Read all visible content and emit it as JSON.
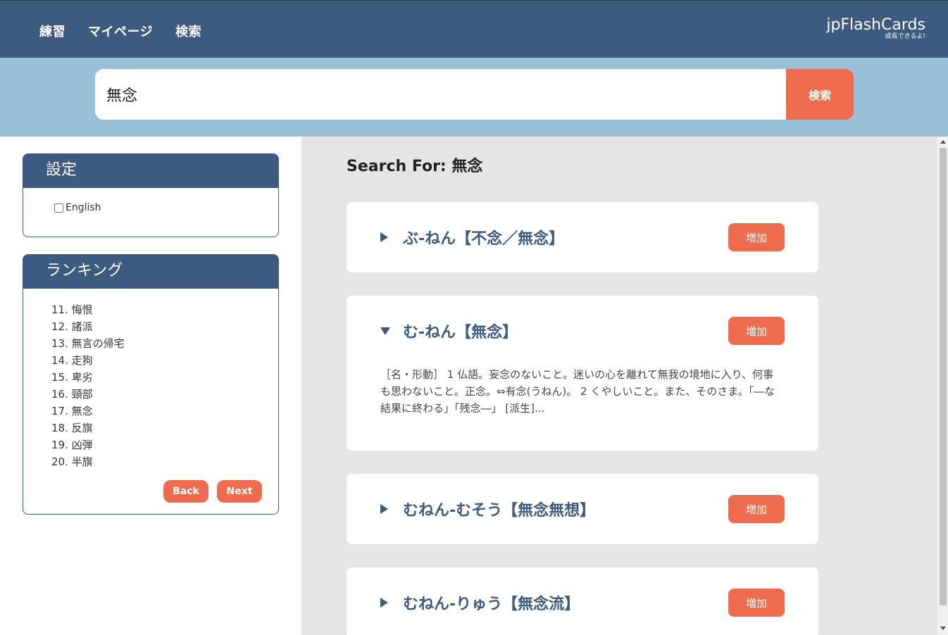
{
  "nav": {
    "items": [
      {
        "label": "練習"
      },
      {
        "label": "マイページ"
      },
      {
        "label": "検索"
      }
    ]
  },
  "brand": {
    "name": "jpFlashCards",
    "tagline": "成長できるよ!"
  },
  "search": {
    "value": "無念",
    "button_label": "検索"
  },
  "settings": {
    "title": "設定",
    "english_label": "English",
    "english_checked": false
  },
  "ranking": {
    "title": "ランキング",
    "items": [
      "11. 悔恨",
      "12. 諸派",
      "13. 無言の帰宅",
      "14. 走狗",
      "15. 卑劣",
      "16. 頸部",
      "17. 無念",
      "18. 反旗",
      "19. 凶弾",
      "20. 半旗"
    ],
    "back_label": "Back",
    "next_label": "Next"
  },
  "results": {
    "heading": "Search For: 無念",
    "add_label": "増加",
    "cards": [
      {
        "title": "ぶ-ねん【不念／無念】",
        "expanded": false,
        "description": ""
      },
      {
        "title": "む-ねん【無念】",
        "expanded": true,
        "description": "［名・形動］ 1 仏語。妄念のないこと。迷いの心を離れて無我の境地に入り、何事も思わないこと。正念。⇔有念(うねん)。 2 くやしいこと。また、そのさま。「―な結果に終わる」「残念―」 [派生]..."
      },
      {
        "title": "むねん-むそう【無念無想】",
        "expanded": false,
        "description": ""
      },
      {
        "title": "むねん-りゅう【無念流】",
        "expanded": false,
        "description": ""
      }
    ]
  },
  "colors": {
    "nav_bg": "#3d5a80",
    "search_band": "#98c1d9",
    "accent": "#ee6c4d",
    "main_bg": "#e5e5e5"
  }
}
